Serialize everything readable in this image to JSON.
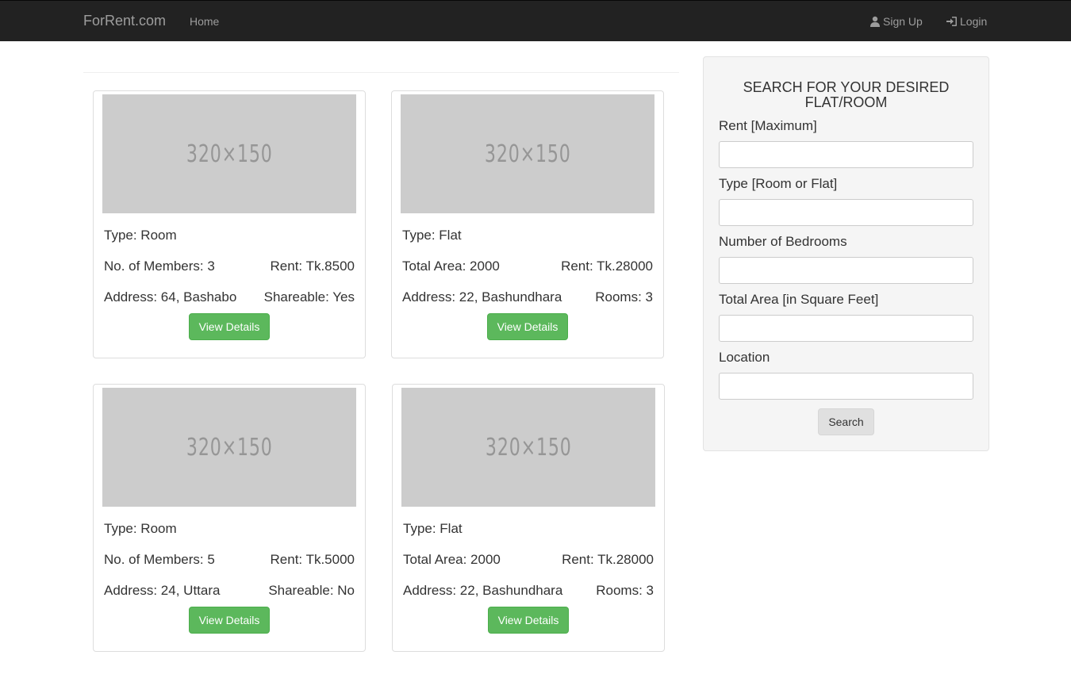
{
  "navbar": {
    "brand": "ForRent.com",
    "home": "Home",
    "signup": "Sign Up",
    "login": "Login"
  },
  "listings": [
    {
      "image_text": "320×150",
      "type": "Type: Room",
      "row2_left": "No. of Members: 3",
      "row2_right": "Rent: Tk.8500",
      "row3_left": "Address: 64, Bashabo",
      "row3_right": "Shareable: Yes",
      "button": "View Details"
    },
    {
      "image_text": "320×150",
      "type": "Type: Flat",
      "row2_left": "Total Area: 2000",
      "row2_right": "Rent: Tk.28000",
      "row3_left": "Address: 22, Bashundhara",
      "row3_right": "Rooms: 3",
      "button": "View Details"
    },
    {
      "image_text": "320×150",
      "type": "Type: Room",
      "row2_left": "No. of Members: 5",
      "row2_right": "Rent: Tk.5000",
      "row3_left": "Address: 24, Uttara",
      "row3_right": "Shareable: No",
      "button": "View Details"
    },
    {
      "image_text": "320×150",
      "type": "Type: Flat",
      "row2_left": "Total Area: 2000",
      "row2_right": "Rent: Tk.28000",
      "row3_left": "Address: 22, Bashundhara",
      "row3_right": "Rooms: 3",
      "button": "View Details"
    }
  ],
  "search": {
    "title": "SEARCH FOR YOUR DESIRED FLAT/ROOM",
    "fields": [
      {
        "label": "Rent [Maximum]",
        "value": ""
      },
      {
        "label": "Type [Room or Flat]",
        "value": ""
      },
      {
        "label": "Number of Bedrooms",
        "value": ""
      },
      {
        "label": "Total Area [in Square Feet]",
        "value": ""
      },
      {
        "label": "Location",
        "value": ""
      }
    ],
    "button": "Search"
  }
}
